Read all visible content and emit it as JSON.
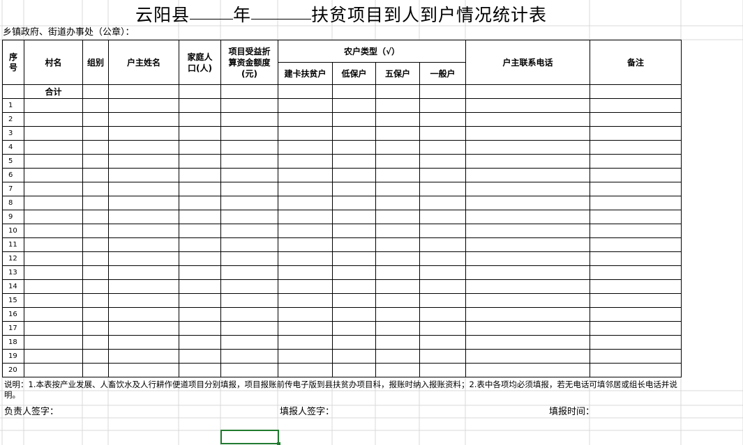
{
  "title": {
    "prefix": "云阳县",
    "year_label": "年",
    "suffix": "扶贫项目到人到户情况统计表"
  },
  "subheader": "乡镇政府、街道办事处（公章）：",
  "table": {
    "headers": {
      "seq": "序号",
      "village": "村名",
      "group": "组别",
      "householder": "户主姓名",
      "family_size": "家庭人口(人)",
      "fund_amount": "项目受益折算资金额度(元)",
      "household_type": "农户类型（√）",
      "type_card": "建卡扶贫户",
      "type_low": "低保户",
      "type_five": "五保户",
      "type_general": "一般户",
      "phone": "户主联系电话",
      "remarks": "备注"
    },
    "total_label": "合计",
    "rows": [
      "1",
      "2",
      "3",
      "4",
      "5",
      "6",
      "7",
      "8",
      "9",
      "10",
      "11",
      "12",
      "13",
      "14",
      "15",
      "16",
      "17",
      "18",
      "19",
      "20"
    ]
  },
  "note": "说明：1.本表按产业发展、人畜饮水及人行耕作便道项目分别填报，项目报账前传电子版到县扶贫办项目科，报账时纳入报账资料；2.表中各项均必须填报，若无电话可填邻居或组长电话并说明。",
  "signatures": {
    "responsible": "负责人签字：",
    "filler": "填报人签字：",
    "date": "填报时间："
  },
  "colors": {
    "selection": "#1f7a2e",
    "gridline": "#d9d9d9"
  }
}
